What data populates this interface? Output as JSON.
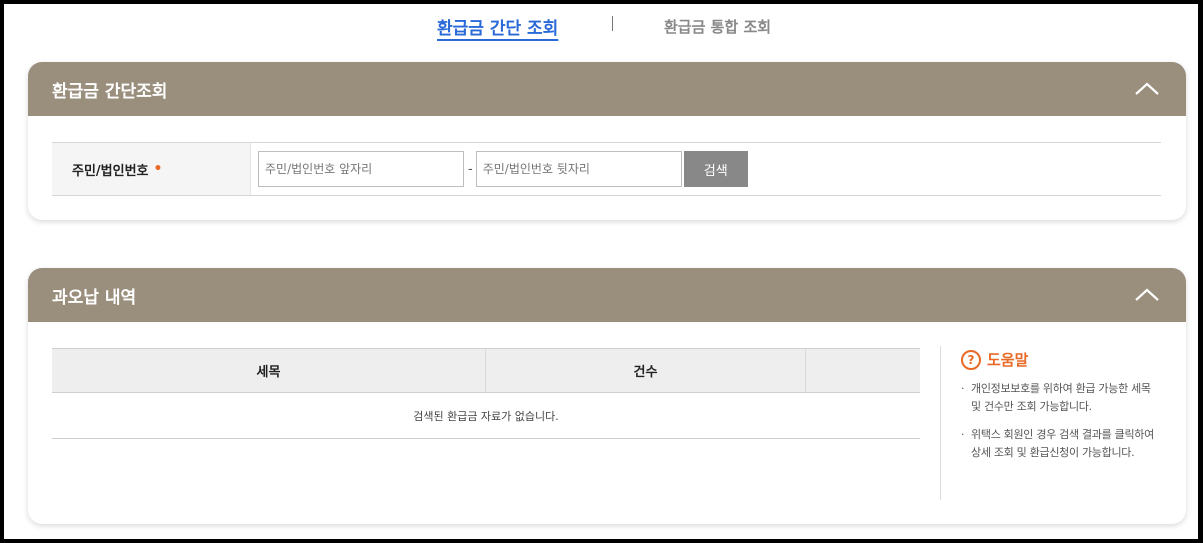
{
  "tabs": {
    "active": "환급금 간단 조회",
    "inactive": "환급금 통합 조회"
  },
  "search_panel": {
    "title": "환급금 간단조회",
    "field_label": "주민/법인번호",
    "required_mark": "•",
    "front_placeholder": "주민/법인번호 앞자리",
    "dash": "-",
    "back_placeholder": "주민/법인번호 뒷자리",
    "search_button": "검색"
  },
  "overpayment_panel": {
    "title": "과오납 내역",
    "columns": [
      "세목",
      "건수",
      ""
    ],
    "empty_message": "검색된 환급금 자료가 없습니다."
  },
  "help": {
    "icon": "?",
    "title": "도움말",
    "items": [
      "개인정보보호를 위하여 환급 가능한 세목 및 건수만 조회 가능합니다.",
      "위택스 회원인 경우 검색 결과를 클릭하여 상세 조회 및 환급신청이 가능합니다."
    ]
  },
  "colors": {
    "header_bg": "#9a8e7d",
    "active_tab": "#2a6ad8",
    "help_accent": "#e86a26",
    "button_bg": "#888888"
  }
}
